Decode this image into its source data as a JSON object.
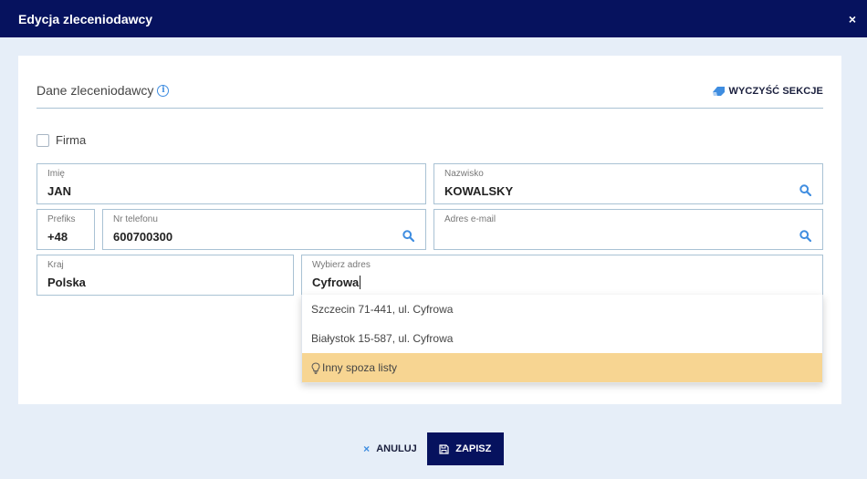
{
  "window": {
    "title": "Edycja zleceniodawcy",
    "close_glyph": "×"
  },
  "section": {
    "title": "Dane zleceniodawcy",
    "info_glyph": "i",
    "clear_label": "WYCZYŚĆ SEKCJE"
  },
  "firma": {
    "label": "Firma",
    "checked": false
  },
  "fields": {
    "imie": {
      "label": "Imię",
      "value": "JAN"
    },
    "nazwisko": {
      "label": "Nazwisko",
      "value": "KOWALSKY"
    },
    "prefiks": {
      "label": "Prefiks",
      "value": "+48"
    },
    "telefon": {
      "label": "Nr telefonu",
      "value": "600700300"
    },
    "email": {
      "label": "Adres e-mail",
      "value": ""
    },
    "kraj": {
      "label": "Kraj",
      "value": "Polska"
    },
    "adres": {
      "label": "Wybierz adres",
      "value": "Cyfrowa"
    }
  },
  "dropdown": {
    "options": [
      {
        "label": "Szczecin 71-441, ul. Cyfrowa"
      },
      {
        "label": "Białystok 15-587, ul. Cyfrowa"
      },
      {
        "label": "Inny spoza listy"
      }
    ]
  },
  "footer": {
    "cancel_glyph": "×",
    "cancel_label": "ANULUJ",
    "save_label": "ZAPISZ"
  },
  "colors": {
    "primary": "#06125e",
    "accent": "#3f8de0",
    "highlight": "#f7d592",
    "border": "#a9c2d4",
    "background": "#e6eef8"
  },
  "icons": [
    "close-icon",
    "info-icon",
    "eraser-icon",
    "search-icon",
    "lightbulb-icon",
    "save-icon"
  ]
}
